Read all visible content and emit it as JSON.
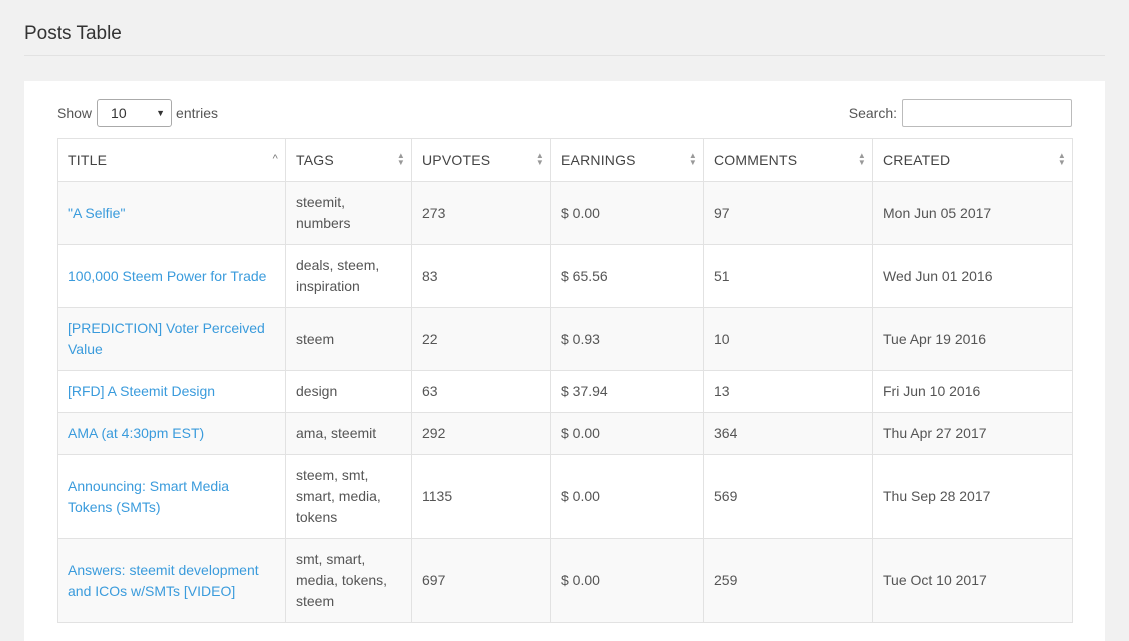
{
  "page": {
    "title": "Posts Table"
  },
  "controls": {
    "show_label": "Show",
    "entries_value": "10",
    "entries_label": "entries",
    "search_label": "Search:",
    "search_value": ""
  },
  "table": {
    "columns": [
      "TITLE",
      "TAGS",
      "UPVOTES",
      "EARNINGS",
      "COMMENTS",
      "CREATED"
    ],
    "rows": [
      {
        "title": "\"A Selfie\"",
        "tags": "steemit, numbers",
        "upvotes": "273",
        "earnings": "$ 0.00",
        "comments": "97",
        "created": "Mon Jun 05 2017"
      },
      {
        "title": "100,000 Steem Power for Trade",
        "tags": "deals, steem, inspiration",
        "upvotes": "83",
        "earnings": "$ 65.56",
        "comments": "51",
        "created": "Wed Jun 01 2016"
      },
      {
        "title": "[PREDICTION] Voter Perceived Value",
        "tags": "steem",
        "upvotes": "22",
        "earnings": "$ 0.93",
        "comments": "10",
        "created": "Tue Apr 19 2016"
      },
      {
        "title": "[RFD] A Steemit Design",
        "tags": "design",
        "upvotes": "63",
        "earnings": "$ 37.94",
        "comments": "13",
        "created": "Fri Jun 10 2016"
      },
      {
        "title": "AMA (at 4:30pm EST)",
        "tags": "ama, steemit",
        "upvotes": "292",
        "earnings": "$ 0.00",
        "comments": "364",
        "created": "Thu Apr 27 2017"
      },
      {
        "title": "Announcing: Smart Media Tokens (SMTs)",
        "tags": "steem, smt, smart, media, tokens",
        "upvotes": "1135",
        "earnings": "$ 0.00",
        "comments": "569",
        "created": "Thu Sep 28 2017"
      },
      {
        "title": "Answers: steemit development and ICOs w/SMTs [VIDEO]",
        "tags": "smt, smart, media, tokens, steem",
        "upvotes": "697",
        "earnings": "$ 0.00",
        "comments": "259",
        "created": "Tue Oct 10 2017"
      }
    ]
  }
}
